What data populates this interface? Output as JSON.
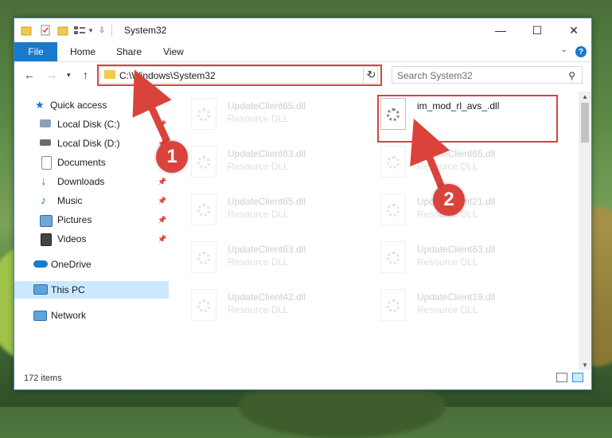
{
  "window": {
    "title": "System32",
    "controls": {
      "minimize": "—",
      "maximize": "☐",
      "close": "✕"
    }
  },
  "ribbon": {
    "file_tab": "File",
    "tabs": [
      "Home",
      "Share",
      "View"
    ],
    "help": "?"
  },
  "navigation": {
    "address": "C:\\Windows\\System32",
    "search_placeholder": "Search System32"
  },
  "sidebar": {
    "items": [
      {
        "label": "Quick access",
        "icon": "star-icon"
      },
      {
        "label": "Local Disk (C:)",
        "icon": "drive-icon"
      },
      {
        "label": "Local Disk (D:)",
        "icon": "drive-icon"
      },
      {
        "label": "Documents",
        "icon": "document-icon"
      },
      {
        "label": "Downloads",
        "icon": "download-icon"
      },
      {
        "label": "Music",
        "icon": "music-icon"
      },
      {
        "label": "Pictures",
        "icon": "pictures-icon"
      },
      {
        "label": "Videos",
        "icon": "videos-icon"
      },
      {
        "label": "OneDrive",
        "icon": "cloud-icon"
      },
      {
        "label": "This PC",
        "icon": "computer-icon"
      },
      {
        "label": "Network",
        "icon": "network-icon"
      }
    ],
    "selected": "This PC"
  },
  "files": [
    {
      "name": "UpdateClient65.dll",
      "type": "Resource DLL"
    },
    {
      "name": "im_mod_rl_avs_.dll",
      "type": ""
    },
    {
      "name": "UpdateClient63.dll",
      "type": "Resource DLL"
    },
    {
      "name": "UpdateClient65.dll",
      "type": "Resource DLL"
    },
    {
      "name": "UpdateClient65.dll",
      "type": "Resource DLL"
    },
    {
      "name": "UpdateClient21.dll",
      "type": "Resource DLL"
    },
    {
      "name": "UpdateClient63.dll",
      "type": "Resource DLL"
    },
    {
      "name": "UpdateClient63.dll",
      "type": "Resource DLL"
    },
    {
      "name": "UpdateClient42.dll",
      "type": "Resource DLL"
    },
    {
      "name": "UpdateClient19.dll",
      "type": "Resource DLL"
    }
  ],
  "status": {
    "item_count": "172 items"
  },
  "annotations": {
    "step1": "1",
    "step2": "2"
  },
  "colors": {
    "accent": "#1979ca",
    "highlight": "#d9433c",
    "selected_bg": "#cce8ff"
  }
}
